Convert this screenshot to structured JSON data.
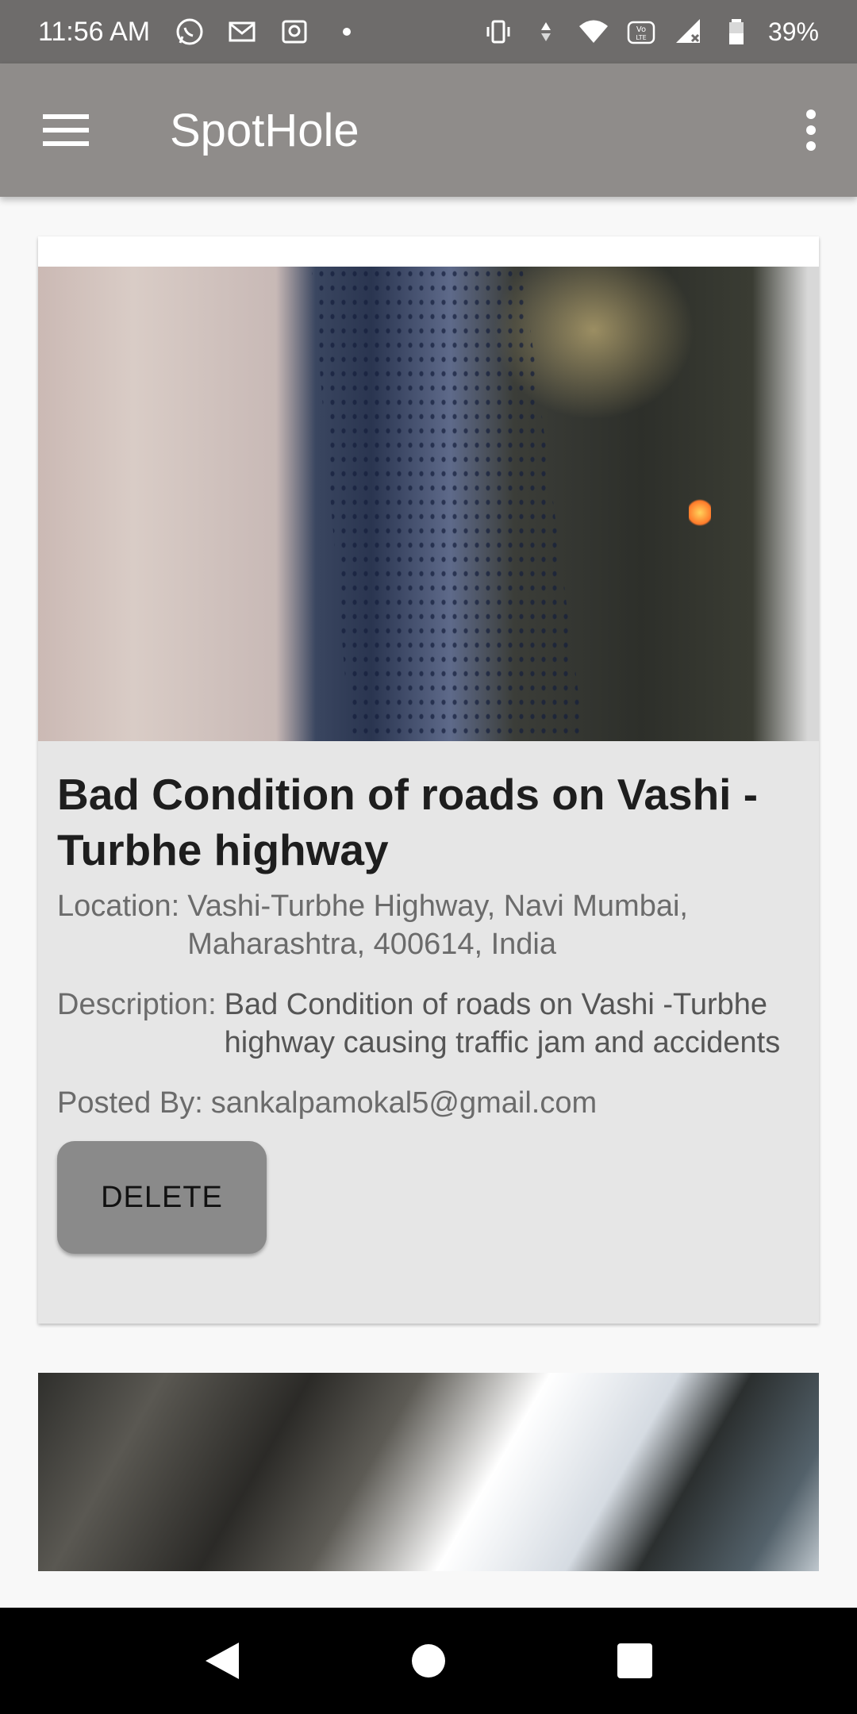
{
  "status_bar": {
    "time": "11:56 AM",
    "battery": "39%",
    "icons_left": [
      "whatsapp-icon",
      "gmail-icon",
      "gallery-icon",
      "dot-icon"
    ],
    "icons_right": [
      "vibrate-icon",
      "data-arrows-icon",
      "wifi-icon",
      "volte-icon",
      "signal-icon",
      "battery-icon"
    ]
  },
  "app_bar": {
    "title": "SpotHole",
    "menu_icon": "hamburger-menu-icon",
    "overflow_icon": "more-vert-icon"
  },
  "posts": [
    {
      "title": "Bad Condition of roads on Vashi -Turbhe highway",
      "location_label": "Location:",
      "location_value": "Vashi-Turbhe Highway, Navi Mumbai, Maharashtra, 400614, India",
      "description_label": "Description:",
      "description_value": "Bad Condition of roads on Vashi -Turbhe highway causing traffic jam and accidents",
      "posted_by_label": "Posted By:",
      "posted_by_value": "sankalpamokal5@gmail.com",
      "delete_label": "DELETE"
    }
  ],
  "nav_bar": {
    "back_icon": "back-triangle-icon",
    "home_icon": "home-circle-icon",
    "recents_icon": "recents-square-icon"
  },
  "colors": {
    "status_bar": "#6e6c6b",
    "app_bar": "#8f8c8a",
    "card": "#e6e6e6",
    "button": "#8a8a8a"
  }
}
